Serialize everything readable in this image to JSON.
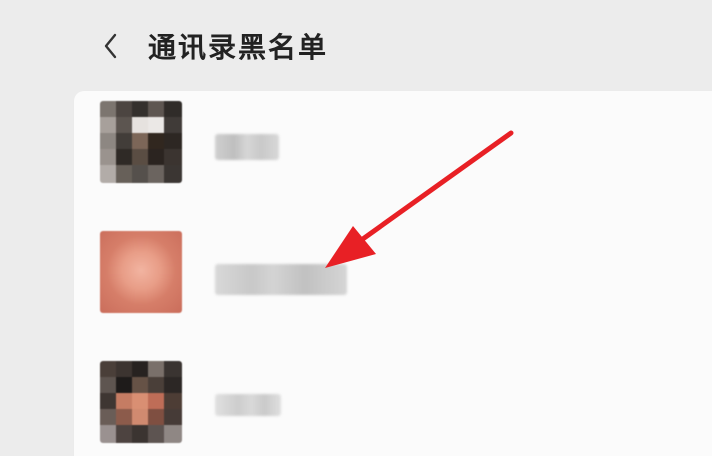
{
  "header": {
    "title": "通讯录黑名单",
    "back_icon": "chevron-left-icon"
  },
  "blacklist": {
    "items": [
      {
        "avatar_icon": "pixelated-avatar-icon"
      },
      {
        "avatar_icon": "pixelated-avatar-icon"
      },
      {
        "avatar_icon": "pixelated-avatar-icon"
      }
    ]
  },
  "annotation": {
    "arrow_icon": "red-arrow-icon",
    "arrow_color": "#e82025"
  },
  "colors": {
    "background": "#ececec",
    "card": "#fbfbfb",
    "title": "#222222"
  }
}
